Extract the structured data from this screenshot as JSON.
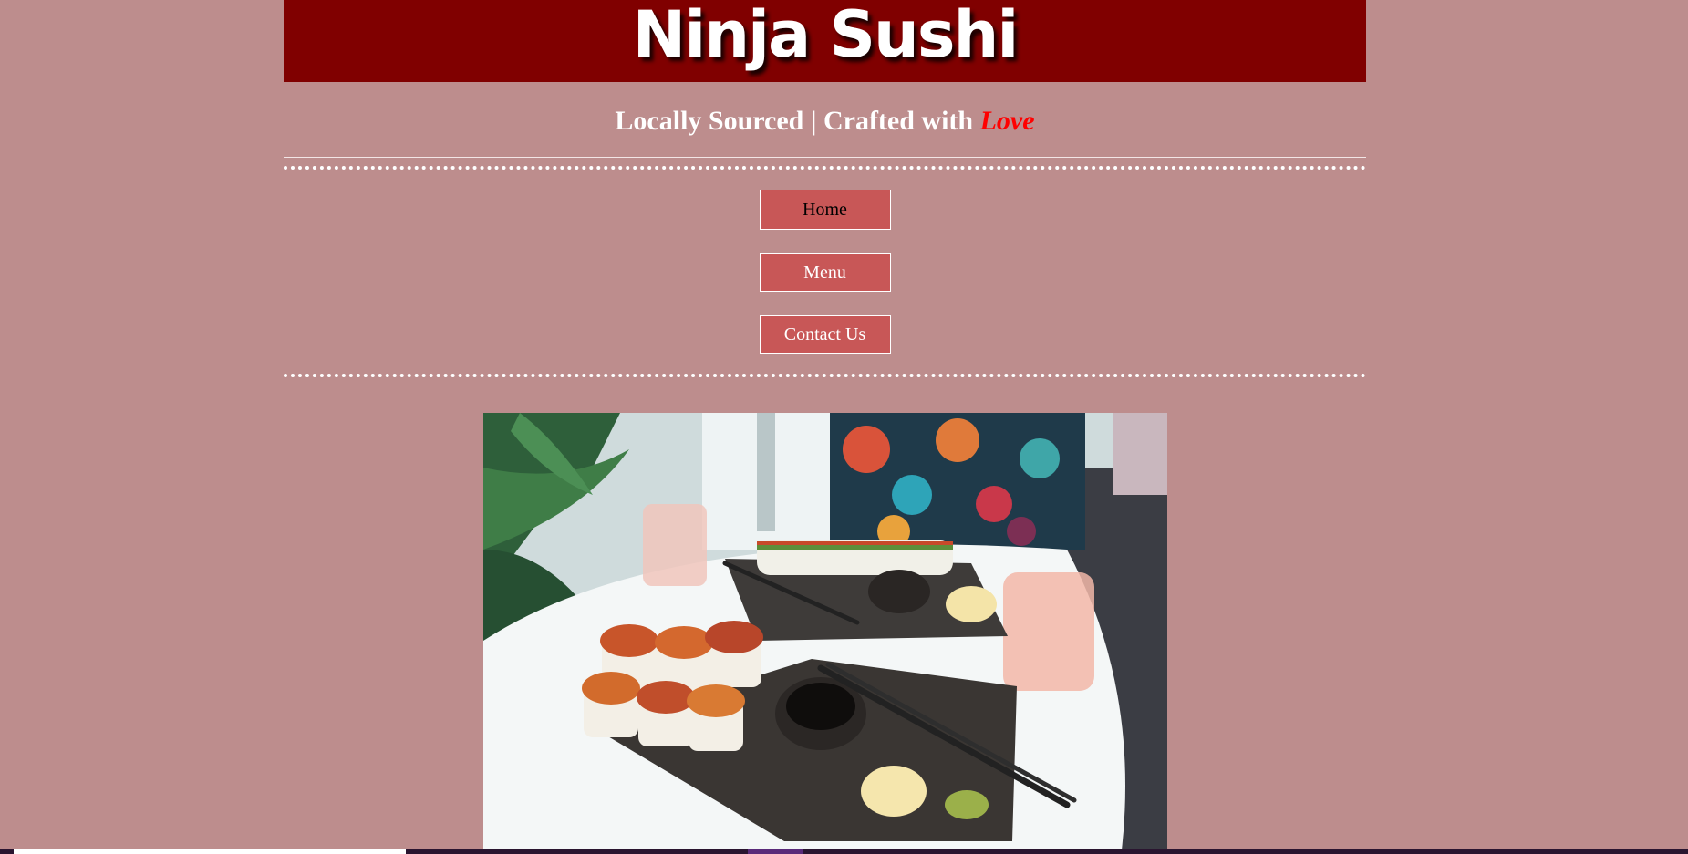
{
  "header": {
    "logo_text": "Ninja Sushi",
    "tagline_prefix": "Locally Sourced | Crafted with",
    "tagline_emphasis": "Love"
  },
  "nav": {
    "items": [
      {
        "label": "Home",
        "active": true
      },
      {
        "label": "Menu",
        "active": false
      },
      {
        "label": "Contact Us",
        "active": false
      }
    ]
  },
  "colors": {
    "page_background": "#bd8d8d",
    "banner": "#800000",
    "nav_button": "#c85757",
    "love_text": "#ff0000"
  },
  "hero": {
    "image_subject": "sushi-rolls-on-slate-plates-with-glasses"
  }
}
